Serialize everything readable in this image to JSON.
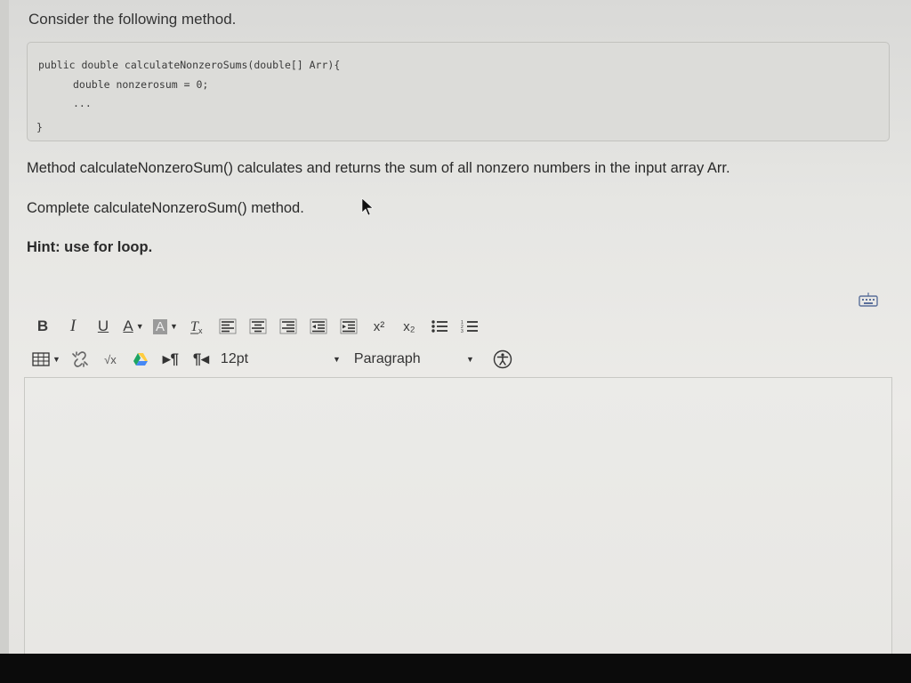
{
  "question": {
    "title": "Consider the following method.",
    "code": [
      "public double calculateNonzeroSums(double[] Arr){",
      "double nonzerosum = 0;",
      "...",
      "}"
    ],
    "description": "Method calculateNonzeroSum() calculates and returns the sum of all nonzero numbers in the input array Arr.",
    "instruction": "Complete calculateNonzeroSum() method.",
    "hint": "Hint: use for loop."
  },
  "toolbar": {
    "bold": "B",
    "italic": "I",
    "underline": "U",
    "font_color": "A",
    "highlight": "A",
    "superscript": "x²",
    "subscript": "x₂",
    "font_size": "12pt",
    "format": "Paragraph"
  },
  "icons": [
    "bold-icon",
    "italic-icon",
    "underline-icon",
    "font-color-icon",
    "highlight-color-icon",
    "clear-formatting-icon",
    "align-left-icon",
    "align-center-icon",
    "align-right-icon",
    "outdent-icon",
    "indent-icon",
    "superscript-icon",
    "subscript-icon",
    "bullet-list-icon",
    "numbered-list-icon",
    "table-icon",
    "unlink-icon",
    "math-icon",
    "google-drive-icon",
    "ltr-icon",
    "rtl-icon",
    "accessibility-icon",
    "keyboard-icon"
  ],
  "colors": {
    "drive_green": "#1da462",
    "drive_yellow": "#ffcd40",
    "drive_blue": "#4688f4"
  }
}
